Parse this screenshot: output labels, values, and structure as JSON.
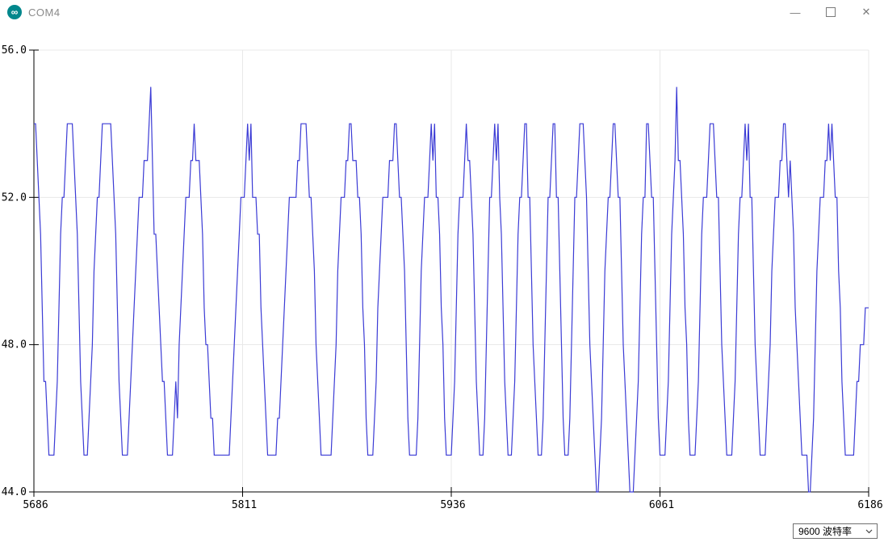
{
  "window": {
    "title": "COM4",
    "logo_glyph": "∞",
    "controls": {
      "minimize": "—",
      "close": "✕"
    }
  },
  "statusbar": {
    "baud_selector_value": "9600 波特率"
  },
  "colors": {
    "line": "#3B3BD5",
    "grid": "#e8e8e8",
    "axis": "#000000",
    "logo_teal": "#00878C",
    "title_text": "#8a8a8a",
    "control_gray": "#7a7a7a"
  },
  "chart_data": {
    "type": "line",
    "title": "",
    "xlabel": "",
    "ylabel": "",
    "xlim": [
      5686,
      6186
    ],
    "ylim": [
      44.0,
      56.0
    ],
    "x_ticks": [
      5686,
      5811,
      5936,
      6061,
      6186
    ],
    "x_tick_labels": [
      "5686",
      "5811",
      "5936",
      "6061",
      "6186"
    ],
    "y_ticks": [
      44.0,
      48.0,
      52.0,
      56.0
    ],
    "y_tick_labels": [
      "44.0",
      "48.0",
      "52.0",
      "56.0"
    ],
    "grid": true,
    "legend": false,
    "x_start": 5686,
    "x_step": 1,
    "values": [
      54,
      54,
      53,
      52,
      51,
      49,
      47,
      47,
      46,
      45,
      45,
      45,
      45,
      46,
      47,
      49,
      51,
      52,
      52,
      53,
      54,
      54,
      54,
      54,
      53,
      52,
      51,
      49,
      47,
      46,
      45,
      45,
      45,
      46,
      47,
      48,
      50,
      51,
      52,
      52,
      53,
      54,
      54,
      54,
      54,
      54,
      54,
      53,
      52,
      51,
      49,
      47,
      46,
      45,
      45,
      45,
      45,
      46,
      47,
      48,
      49,
      50,
      51,
      52,
      52,
      52,
      53,
      53,
      53,
      54,
      55,
      53,
      51,
      51,
      50,
      49,
      48,
      47,
      47,
      46,
      45,
      45,
      45,
      45,
      46,
      47,
      46,
      48,
      49,
      50,
      51,
      52,
      52,
      52,
      53,
      53,
      54,
      53,
      53,
      53,
      52,
      51,
      49,
      48,
      48,
      47,
      46,
      46,
      45,
      45,
      45,
      45,
      45,
      45,
      45,
      45,
      45,
      45,
      46,
      47,
      48,
      49,
      50,
      51,
      52,
      52,
      52,
      53,
      54,
      53,
      54,
      52,
      52,
      52,
      51,
      51,
      49,
      48,
      47,
      46,
      45,
      45,
      45,
      45,
      45,
      45,
      46,
      46,
      47,
      48,
      49,
      50,
      51,
      52,
      52,
      52,
      52,
      52,
      53,
      53,
      54,
      54,
      54,
      54,
      53,
      52,
      52,
      51,
      50,
      48,
      47,
      46,
      45,
      45,
      45,
      45,
      45,
      45,
      45,
      46,
      47,
      48,
      50,
      51,
      52,
      52,
      52,
      53,
      53,
      54,
      54,
      53,
      53,
      53,
      52,
      52,
      51,
      49,
      48,
      46,
      45,
      45,
      45,
      45,
      46,
      47,
      49,
      50,
      51,
      52,
      52,
      52,
      52,
      53,
      53,
      53,
      54,
      54,
      53,
      52,
      52,
      51,
      50,
      48,
      46,
      45,
      45,
      45,
      45,
      45,
      46,
      48,
      50,
      51,
      52,
      52,
      52,
      53,
      54,
      53,
      54,
      52,
      52,
      51,
      49,
      48,
      46,
      45,
      45,
      45,
      45,
      46,
      47,
      49,
      51,
      52,
      52,
      52,
      53,
      54,
      53,
      53,
      52,
      51,
      49,
      47,
      46,
      45,
      45,
      45,
      46,
      48,
      50,
      52,
      52,
      53,
      54,
      53,
      54,
      52,
      51,
      49,
      47,
      46,
      45,
      45,
      45,
      46,
      47,
      49,
      51,
      52,
      52,
      53,
      54,
      54,
      52,
      52,
      50,
      48,
      47,
      46,
      45,
      45,
      45,
      46,
      48,
      50,
      52,
      52,
      53,
      54,
      54,
      52,
      52,
      50,
      48,
      46,
      45,
      45,
      45,
      46,
      48,
      50,
      52,
      52,
      53,
      54,
      54,
      54,
      53,
      52,
      50,
      48,
      47,
      46,
      45,
      44,
      44,
      45,
      46,
      48,
      50,
      51,
      52,
      52,
      53,
      54,
      54,
      53,
      52,
      52,
      50,
      48,
      47,
      46,
      45,
      44,
      44,
      44,
      45,
      46,
      47,
      49,
      51,
      52,
      52,
      54,
      54,
      53,
      52,
      52,
      50,
      48,
      46,
      45,
      45,
      45,
      45,
      46,
      47,
      49,
      51,
      52,
      53,
      55,
      53,
      53,
      52,
      51,
      49,
      48,
      46,
      45,
      45,
      45,
      45,
      46,
      47,
      49,
      51,
      52,
      52,
      52,
      53,
      54,
      54,
      54,
      53,
      52,
      52,
      50,
      48,
      47,
      46,
      45,
      45,
      45,
      45,
      46,
      47,
      49,
      51,
      52,
      52,
      53,
      54,
      53,
      54,
      52,
      52,
      50,
      48,
      47,
      46,
      45,
      45,
      45,
      45,
      46,
      47,
      48,
      50,
      51,
      52,
      52,
      52,
      53,
      53,
      54,
      54,
      53,
      52,
      53,
      52,
      51,
      49,
      48,
      47,
      46,
      45,
      45,
      45,
      45,
      44,
      44,
      45,
      46,
      48,
      50,
      51,
      52,
      52,
      52,
      53,
      53,
      54,
      53,
      54,
      53,
      52,
      52,
      50,
      49,
      47,
      46,
      45,
      45,
      45,
      45,
      45,
      45,
      46,
      47,
      47,
      48,
      48,
      48,
      49,
      49,
      49
    ]
  }
}
